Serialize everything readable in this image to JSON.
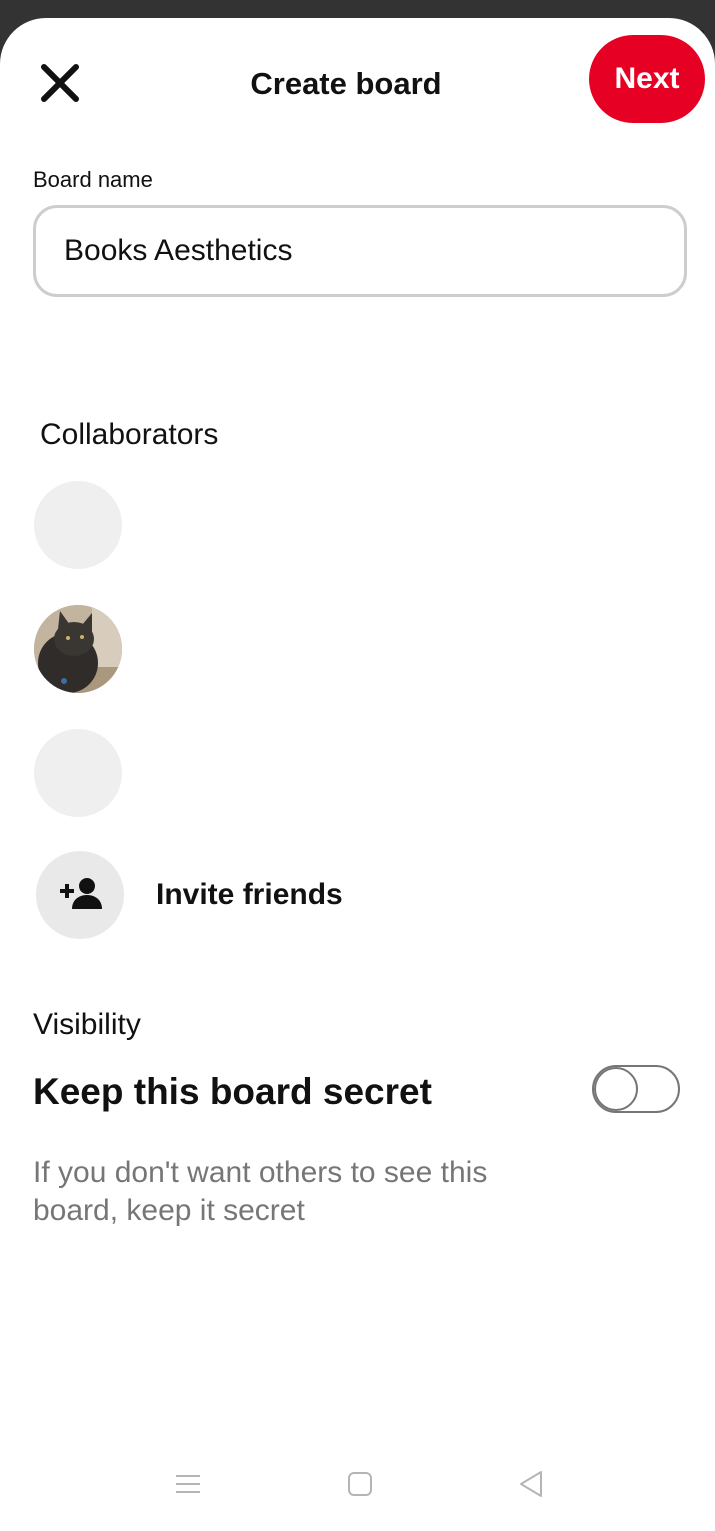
{
  "header": {
    "close_icon": "close-icon",
    "title": "Create board",
    "next_label": "Next",
    "accent_color": "#e60023"
  },
  "board_name": {
    "label": "Board name",
    "value": "Books Aesthetics"
  },
  "collaborators": {
    "title": "Collaborators",
    "avatars": [
      {
        "type": "placeholder"
      },
      {
        "type": "photo",
        "subject": "dark grey cat"
      },
      {
        "type": "placeholder"
      }
    ],
    "invite_icon": "add-person-icon",
    "invite_label": "Invite friends"
  },
  "visibility": {
    "label": "Visibility",
    "secret_title": "Keep this board secret",
    "secret_on": false,
    "description": "If you don't want others to see this board, keep it secret"
  },
  "system_nav": {
    "icons": [
      "menu-icon",
      "home-square-icon",
      "back-triangle-icon"
    ]
  }
}
